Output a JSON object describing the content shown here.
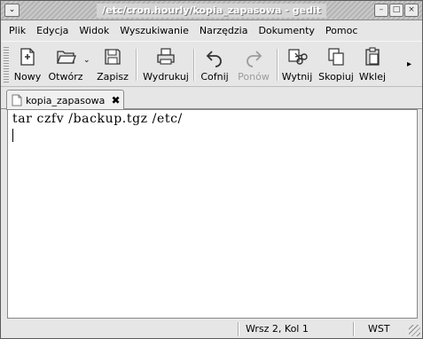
{
  "window": {
    "title": "/etc/cron.hourly/kopia_zapasowa - gedit"
  },
  "window_buttons": {
    "menu_glyph": "⌄",
    "minimize_glyph": "–",
    "maximize_glyph": "□",
    "close_glyph": "×"
  },
  "menubar": {
    "items": [
      "Plik",
      "Edycja",
      "Widok",
      "Wyszukiwanie",
      "Narzędzia",
      "Dokumenty",
      "Pomoc"
    ]
  },
  "toolbar": {
    "new_label": "Nowy",
    "open_label": "Otwórz",
    "save_label": "Zapisz",
    "print_label": "Wydrukuj",
    "undo_label": "Cofnij",
    "redo_label": "Ponów",
    "cut_label": "Wytnij",
    "copy_label": "Skopiuj",
    "paste_label": "Wklej",
    "more_glyph": "▸",
    "dropdown_glyph": "⌄"
  },
  "tab": {
    "label": "kopia_zapasowa",
    "close_glyph": "✖"
  },
  "editor": {
    "content": "tar czfv /backup.tgz /etc/"
  },
  "statusbar": {
    "position": "Wrsz 2, Kol 1",
    "mode": "WST"
  }
}
